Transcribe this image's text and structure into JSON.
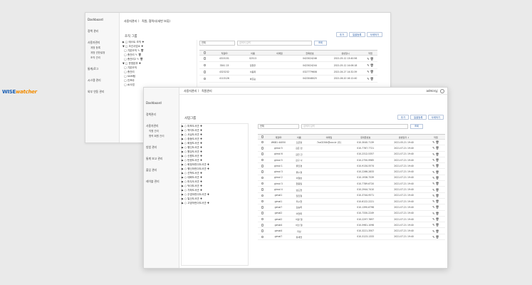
{
  "back_window": {
    "sidebar": [
      {
        "label": "Dashboard",
        "type": "head"
      },
      {
        "label": "정책 관리",
        "type": "item",
        "gap": true
      },
      {
        "label": "사용자관리",
        "type": "item",
        "gap": true
      },
      {
        "label": "계정 등록",
        "type": "sub"
      },
      {
        "label": "계정 권한설정",
        "type": "sub"
      },
      {
        "label": "조직 관리",
        "type": "sub"
      },
      {
        "label": "통계/로그",
        "type": "item",
        "gap": true
      },
      {
        "label": "시스템 관리",
        "type": "item",
        "gap": true
      },
      {
        "label": "외부 연동 관리",
        "type": "item",
        "gap": true
      }
    ],
    "breadcrumb": "사용자관리 〉 직원, 협력사(세번 보류)",
    "section_title": "조직 그룹",
    "buttons": [
      "추가",
      "일괄등록",
      "삭제하기"
    ],
    "tree": [
      "▶ □ 테스트 조직 ✚",
      "▼ □ 조선사업소 ✚",
      "  □ 기본조직 ✎ 🗑",
      "  □ 총관리 ✎ 🗑",
      "  □ 총관리2 ✎ 🗑",
      "▼ □ 운영본부 ✚",
      "  □ 기본조직",
      "  □ 총관리",
      "  □ SAM팀",
      "  □ 인프라",
      "  □ AI사업"
    ],
    "filter": {
      "select": "전체",
      "placeholder": "검색어 입력",
      "button": "조회"
    },
    "columns": [
      "",
      "직원ID",
      "이름",
      "이메일",
      "전화번호",
      "생성일시",
      "작업"
    ],
    "rows": [
      [
        "",
        "4315151",
        "02513",
        "",
        "0423024246",
        "2021.05.12 13:40:56",
        ""
      ],
      [
        "",
        "3341 23",
        "정현주",
        "",
        "0423024244",
        "2021.05.12 14:06:18",
        ""
      ],
      [
        "",
        "4323232",
        "이동희",
        "",
        "0327779608",
        "2021.04.27 14:32:39",
        ""
      ],
      [
        "",
        "4113126",
        "박흥순",
        "",
        "0423048025",
        "2021.06.20 16:12:40",
        ""
      ]
    ]
  },
  "front_window": {
    "logo_part1": "WISE",
    "logo_part2": "watcher",
    "sidebar": [
      {
        "label": "Dashboard",
        "type": "head"
      },
      {
        "label": "정책관리",
        "type": "item",
        "gap": true
      },
      {
        "label": "사용자관리",
        "type": "item",
        "gap": true
      },
      {
        "label": "직원 관리",
        "type": "sub"
      },
      {
        "label": "협력 회원 관리",
        "type": "sub"
      },
      {
        "label": "방법 관리",
        "type": "item",
        "gap": true
      },
      {
        "label": "통계 보고 관리",
        "type": "item",
        "gap": true
      },
      {
        "label": "출입 관리",
        "type": "item",
        "gap": true
      },
      {
        "label": "레이블 관리",
        "type": "item",
        "gap": true
      }
    ],
    "breadcrumb": "사용자관리 〉 직원관리",
    "user": "admin님",
    "section_title": "사업그룹",
    "buttons": [
      "추가",
      "일괄등록",
      "삭제하기"
    ],
    "tree": [
      "▶ ○ 마포도서관 ✚",
      "▶ ○ 백석도서관 ✚",
      "▶ ○ 서삼도서관 ✚",
      "▶ ○ 중동도서관 ✚",
      "▶ ○ 화정도서관 ✚",
      "▶ ○ 행신도서관 ✚",
      "▶ ○ 원당도서관 ✚",
      "▶ ○ 신원도서관 ✚",
      "▶ ○ 탄현도서관 ✚",
      "▶ ○ 화정어린이도서관 ✚",
      "▶ ○ 행신어린이도서관 ✚",
      "▶ ○ 선학도서관 ✚",
      "▶ ○ 대화도서관 ✚",
      "▶ ○ 마두도서관 ✚",
      "▶ ○ 덕이도서관 ✚",
      "▶ ○ 가좌도서관 ✚",
      "▶ ○ 주엽어린이도서관 ✚",
      "▶ ○ 일산도서관 ✚",
      "▶ ○ 고양어린이도서관 ✚"
    ],
    "filter": {
      "select": "전체",
      "placeholder": "검색어 입력",
      "button": "조회"
    },
    "columns": [
      "",
      "계정ID",
      "이름",
      "이메일",
      "휴대폰번호",
      "생성일자 ↓",
      "작업"
    ],
    "rows": [
      [
        "",
        "WKB1 44050",
        "오은영",
        "7xx0234k@xxx.kr (주)",
        "010-3040-7139",
        "2021.05.21 19:40",
        ""
      ],
      [
        "",
        "gimal 5",
        "김혼 린",
        "",
        "010-7767-7721",
        "2021.07.21 19:40",
        ""
      ],
      [
        "",
        "gimal 6",
        "김전 건",
        "",
        "010-2312-5357",
        "2021.07.21 19:40",
        ""
      ],
      [
        "",
        "gimal 5",
        "김구 나",
        "",
        "010-2750-9965",
        "2021.07.21 19:40",
        ""
      ],
      [
        "",
        "gimal 1",
        "류진경",
        "",
        "010-9134-5574",
        "2021.07.21 19:40",
        ""
      ],
      [
        "",
        "gimal 3",
        "류수경",
        "",
        "010-2266-2833",
        "2021.07.21 19:40",
        ""
      ],
      [
        "",
        "gimal 2",
        "이철호",
        "",
        "010-1936-7539",
        "2021.07.21 19:40",
        ""
      ],
      [
        "",
        "gimal 3",
        "한종일",
        "",
        "010-7789-6720",
        "2021.07.21 19:40",
        ""
      ],
      [
        "",
        "gimal 4",
        "남도현",
        "",
        "010-2944-7410",
        "2021.07.21 19:40",
        ""
      ],
      [
        "",
        "gimal1",
        "임진철",
        "",
        "010-3744-9571",
        "2021.07.21 19:40",
        ""
      ],
      [
        "",
        "gimal1",
        "우수현",
        "",
        "010-6122-2221",
        "2021.07.21 19:40",
        ""
      ],
      [
        "",
        "gimal7",
        "김승희",
        "",
        "010-1390-6798",
        "2021.07.21 19:40",
        ""
      ],
      [
        "",
        "gimal2",
        "이연희",
        "",
        "010-7330-2249",
        "2021.07.21 19:40",
        ""
      ],
      [
        "",
        "gimal2",
        "이광 철",
        "",
        "010-2297-7697",
        "2021.07.21 19:40",
        ""
      ],
      [
        "",
        "gimal4",
        "이잇 철",
        "",
        "010-5981-1098",
        "2021.07.21 19:40",
        ""
      ],
      [
        "",
        "gimal4",
        "지남",
        "",
        "010-3221-3507",
        "2021.07.21 19:40",
        ""
      ],
      [
        "",
        "gimal7",
        "유세연",
        "",
        "010-3123-1333",
        "2021.07.21 19:40",
        ""
      ]
    ]
  }
}
